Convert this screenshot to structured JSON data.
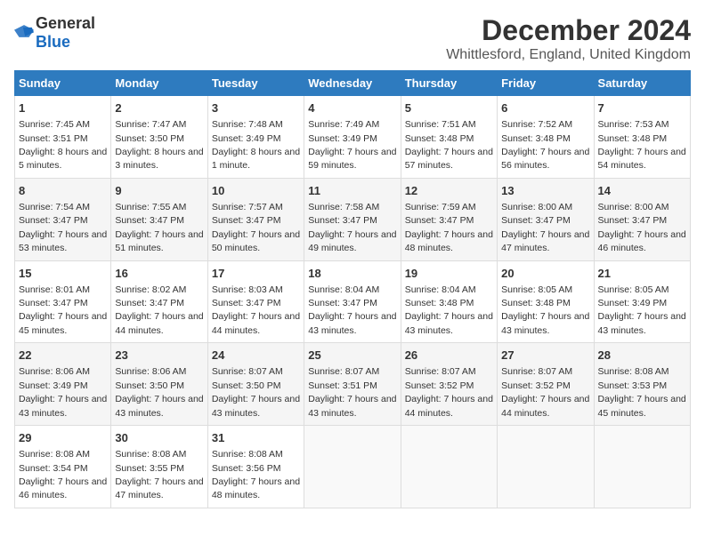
{
  "header": {
    "logo_general": "General",
    "logo_blue": "Blue",
    "main_title": "December 2024",
    "sub_title": "Whittlesford, England, United Kingdom"
  },
  "calendar": {
    "days_of_week": [
      "Sunday",
      "Monday",
      "Tuesday",
      "Wednesday",
      "Thursday",
      "Friday",
      "Saturday"
    ],
    "weeks": [
      [
        null,
        {
          "day": "1",
          "sunrise": "7:45 AM",
          "sunset": "3:51 PM",
          "daylight": "8 hours and 5 minutes."
        },
        {
          "day": "2",
          "sunrise": "7:47 AM",
          "sunset": "3:50 PM",
          "daylight": "8 hours and 3 minutes."
        },
        {
          "day": "3",
          "sunrise": "7:48 AM",
          "sunset": "3:49 PM",
          "daylight": "8 hours and 1 minute."
        },
        {
          "day": "4",
          "sunrise": "7:49 AM",
          "sunset": "3:49 PM",
          "daylight": "7 hours and 59 minutes."
        },
        {
          "day": "5",
          "sunrise": "7:51 AM",
          "sunset": "3:48 PM",
          "daylight": "7 hours and 57 minutes."
        },
        {
          "day": "6",
          "sunrise": "7:52 AM",
          "sunset": "3:48 PM",
          "daylight": "7 hours and 56 minutes."
        },
        {
          "day": "7",
          "sunrise": "7:53 AM",
          "sunset": "3:48 PM",
          "daylight": "7 hours and 54 minutes."
        }
      ],
      [
        {
          "day": "8",
          "sunrise": "7:54 AM",
          "sunset": "3:47 PM",
          "daylight": "7 hours and 53 minutes."
        },
        {
          "day": "9",
          "sunrise": "7:55 AM",
          "sunset": "3:47 PM",
          "daylight": "7 hours and 51 minutes."
        },
        {
          "day": "10",
          "sunrise": "7:57 AM",
          "sunset": "3:47 PM",
          "daylight": "7 hours and 50 minutes."
        },
        {
          "day": "11",
          "sunrise": "7:58 AM",
          "sunset": "3:47 PM",
          "daylight": "7 hours and 49 minutes."
        },
        {
          "day": "12",
          "sunrise": "7:59 AM",
          "sunset": "3:47 PM",
          "daylight": "7 hours and 48 minutes."
        },
        {
          "day": "13",
          "sunrise": "8:00 AM",
          "sunset": "3:47 PM",
          "daylight": "7 hours and 47 minutes."
        },
        {
          "day": "14",
          "sunrise": "8:00 AM",
          "sunset": "3:47 PM",
          "daylight": "7 hours and 46 minutes."
        }
      ],
      [
        {
          "day": "15",
          "sunrise": "8:01 AM",
          "sunset": "3:47 PM",
          "daylight": "7 hours and 45 minutes."
        },
        {
          "day": "16",
          "sunrise": "8:02 AM",
          "sunset": "3:47 PM",
          "daylight": "7 hours and 44 minutes."
        },
        {
          "day": "17",
          "sunrise": "8:03 AM",
          "sunset": "3:47 PM",
          "daylight": "7 hours and 44 minutes."
        },
        {
          "day": "18",
          "sunrise": "8:04 AM",
          "sunset": "3:47 PM",
          "daylight": "7 hours and 43 minutes."
        },
        {
          "day": "19",
          "sunrise": "8:04 AM",
          "sunset": "3:48 PM",
          "daylight": "7 hours and 43 minutes."
        },
        {
          "day": "20",
          "sunrise": "8:05 AM",
          "sunset": "3:48 PM",
          "daylight": "7 hours and 43 minutes."
        },
        {
          "day": "21",
          "sunrise": "8:05 AM",
          "sunset": "3:49 PM",
          "daylight": "7 hours and 43 minutes."
        }
      ],
      [
        {
          "day": "22",
          "sunrise": "8:06 AM",
          "sunset": "3:49 PM",
          "daylight": "7 hours and 43 minutes."
        },
        {
          "day": "23",
          "sunrise": "8:06 AM",
          "sunset": "3:50 PM",
          "daylight": "7 hours and 43 minutes."
        },
        {
          "day": "24",
          "sunrise": "8:07 AM",
          "sunset": "3:50 PM",
          "daylight": "7 hours and 43 minutes."
        },
        {
          "day": "25",
          "sunrise": "8:07 AM",
          "sunset": "3:51 PM",
          "daylight": "7 hours and 43 minutes."
        },
        {
          "day": "26",
          "sunrise": "8:07 AM",
          "sunset": "3:52 PM",
          "daylight": "7 hours and 44 minutes."
        },
        {
          "day": "27",
          "sunrise": "8:07 AM",
          "sunset": "3:52 PM",
          "daylight": "7 hours and 44 minutes."
        },
        {
          "day": "28",
          "sunrise": "8:08 AM",
          "sunset": "3:53 PM",
          "daylight": "7 hours and 45 minutes."
        }
      ],
      [
        {
          "day": "29",
          "sunrise": "8:08 AM",
          "sunset": "3:54 PM",
          "daylight": "7 hours and 46 minutes."
        },
        {
          "day": "30",
          "sunrise": "8:08 AM",
          "sunset": "3:55 PM",
          "daylight": "7 hours and 47 minutes."
        },
        {
          "day": "31",
          "sunrise": "8:08 AM",
          "sunset": "3:56 PM",
          "daylight": "7 hours and 48 minutes."
        },
        null,
        null,
        null,
        null
      ]
    ]
  }
}
